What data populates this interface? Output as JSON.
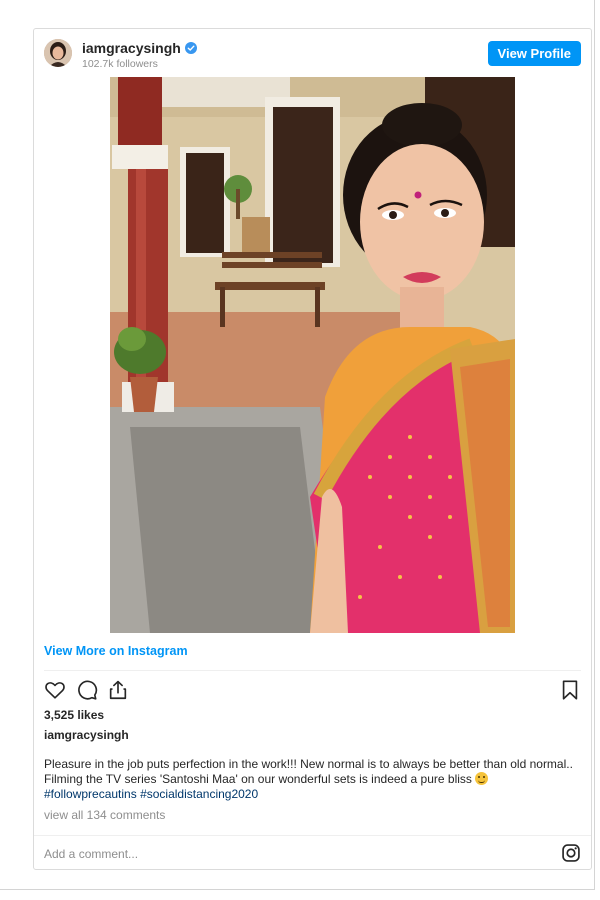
{
  "post": {
    "username": "iamgracysingh",
    "followers": "102.7k followers",
    "view_profile_label": "View Profile",
    "view_more_label": "View More on Instagram",
    "likes": "3,525 likes",
    "owner": "iamgracysingh",
    "caption_text": "Pleasure in the job puts perfection in the work!!! New normal is to always be better than old normal.. Filming the TV series 'Santoshi Maa' on our wonderful sets is indeed a pure bliss",
    "hashtags": [
      "#followprecautins",
      "#socialdistancing2020"
    ],
    "view_comments": "view all 134 comments",
    "comment_placeholder": "Add a comment..."
  },
  "icons": {
    "verified": "verified-badge-icon",
    "like": "heart-icon",
    "comment": "comment-icon",
    "share": "share-icon",
    "save": "bookmark-icon",
    "instagram": "instagram-logo-icon"
  },
  "colors": {
    "accent": "#0095f6",
    "hashtag": "#00376b",
    "muted": "#8e8e8e"
  }
}
